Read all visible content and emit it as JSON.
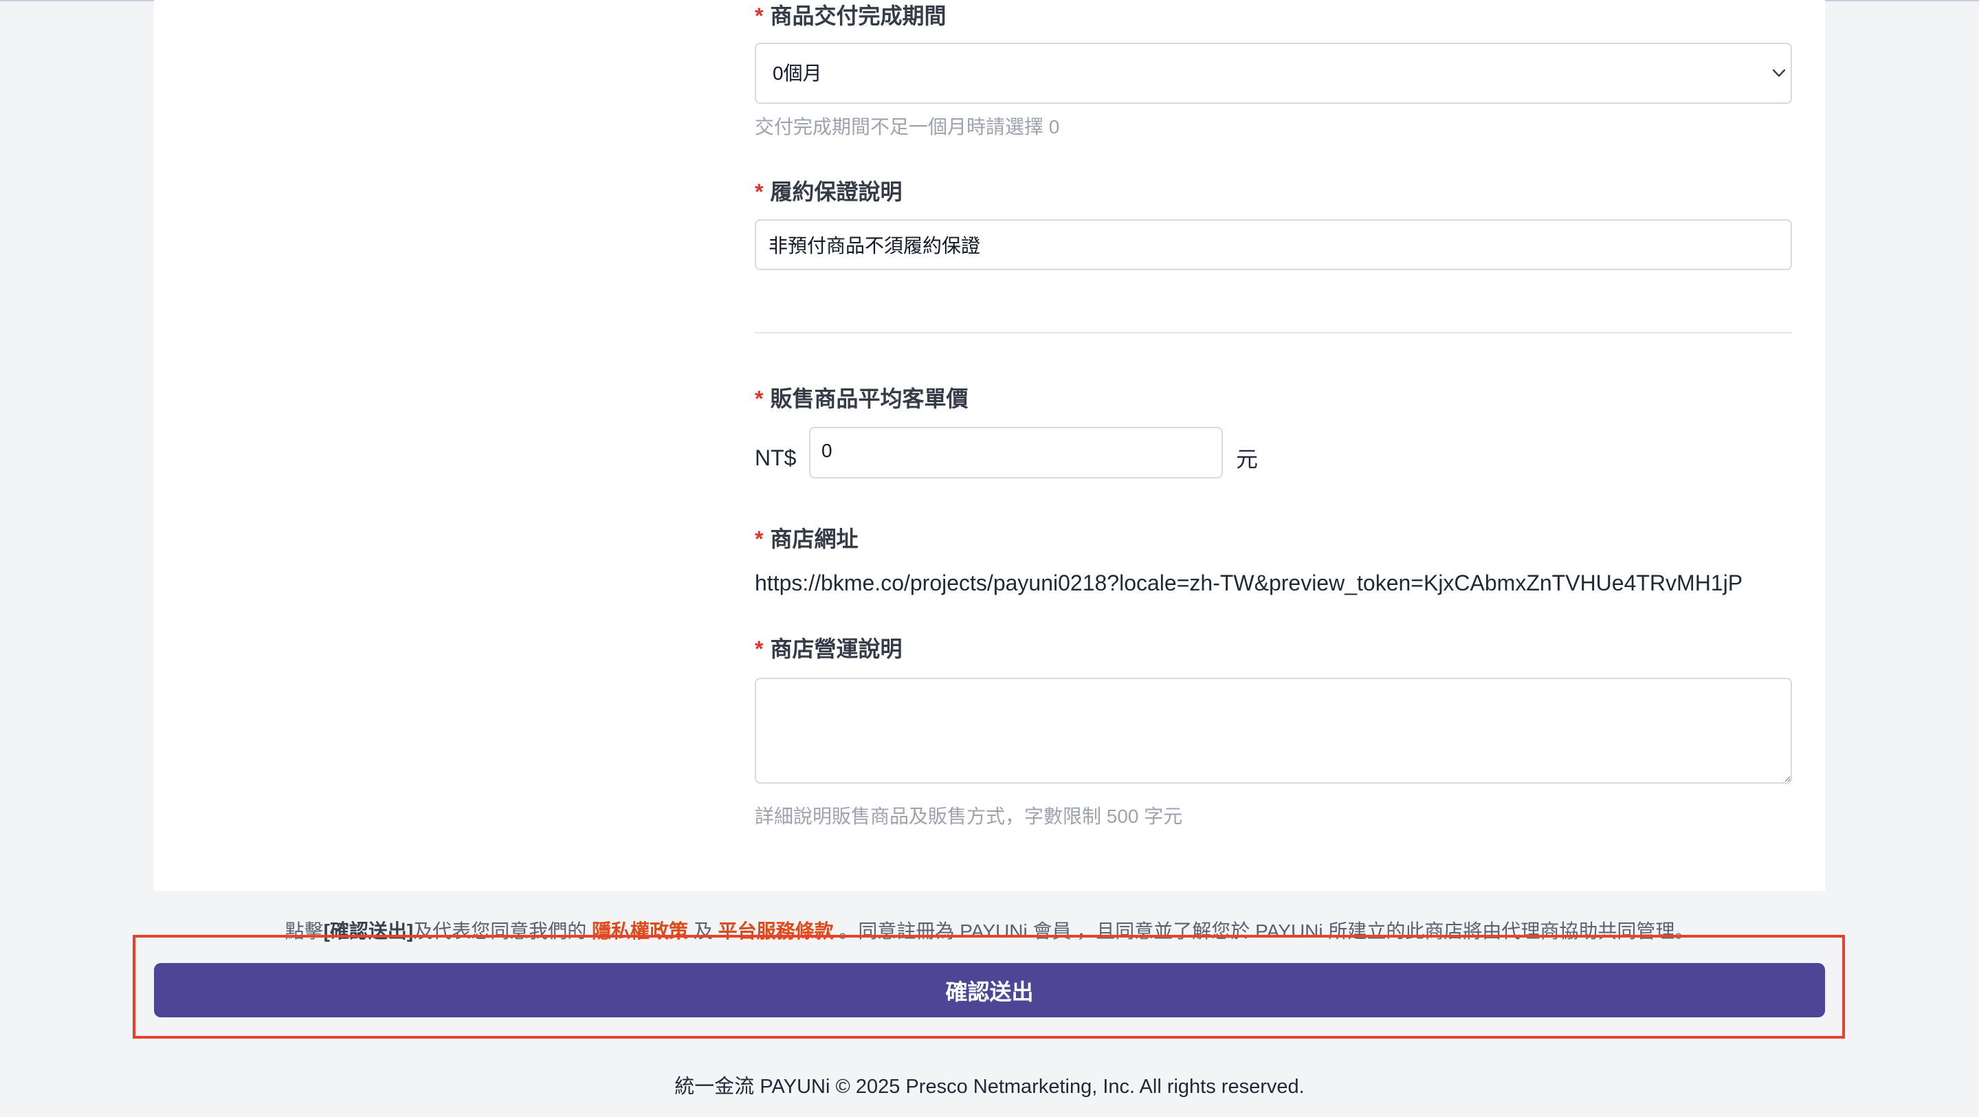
{
  "theme": {
    "accent_color": "#4f4597",
    "required_color": "#e5312b",
    "link_color": "#dd4b1a",
    "highlight_color": "#e5432b",
    "background_color": "#f3f4f6"
  },
  "icons": {
    "select_icon": "chevron-down-icon"
  },
  "form": {
    "required_mark": "*",
    "delivery_period": {
      "label": "商品交付完成期間",
      "value": "0個月",
      "help": "交付完成期間不足一個月時請選擇 0"
    },
    "performance_guarantee": {
      "label": "履約保證說明",
      "value": "非預付商品不須履約保證"
    },
    "average_price": {
      "label": "販售商品平均客單價",
      "prefix": "NT$",
      "value": "0",
      "suffix": "元"
    },
    "store_url": {
      "label": "商店網址",
      "value": "https://bkme.co/projects/payuni0218?locale=zh-TW&preview_token=KjxCAbmxZnTVHUe4TRvMH1jP"
    },
    "store_description": {
      "label": "商店營運說明",
      "value": "",
      "help": "詳細說明販售商品及販售方式，字數限制 500 字元"
    }
  },
  "agreement": {
    "prefix": "點擊",
    "action": "[確認送出]",
    "text_1": "及代表您同意我們的 ",
    "privacy_link": "隱私權政策",
    "conjunction": " 及 ",
    "terms_link": "平台服務條款",
    "text_2": " 。同意註冊為 PAYUNi 會員 ，且同意並了解您於 PAYUNi 所建立的此商店將由代理商協助共同管理。"
  },
  "submit_button": {
    "label": "確認送出"
  },
  "footer": {
    "copyright": "統一金流 PAYUNi © 2025 Presco Netmarketing, Inc. All rights reserved."
  }
}
